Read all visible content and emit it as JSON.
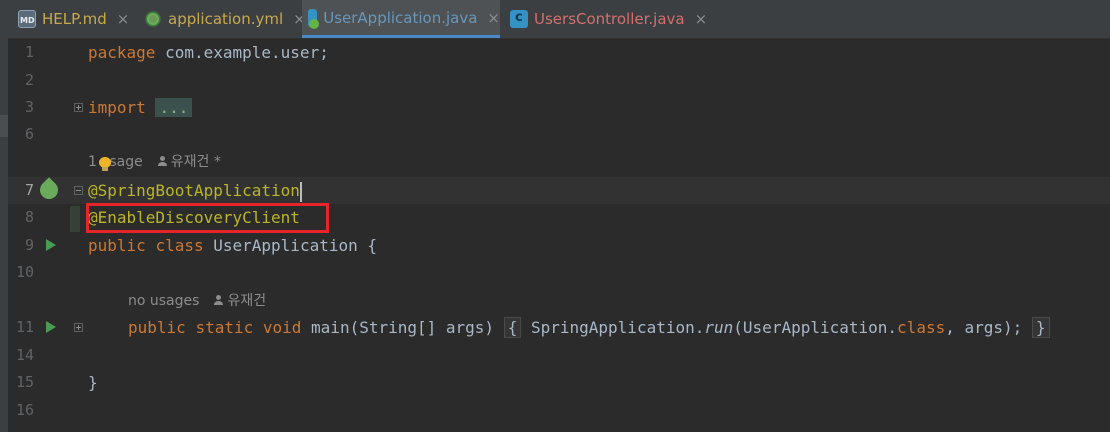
{
  "tabs": [
    {
      "label": "HELP.md",
      "icon": "markdown-file-icon",
      "color": "#c7a94e",
      "active": false
    },
    {
      "label": "application.yml",
      "icon": "yaml-file-icon",
      "color": "#c7a94e",
      "active": false
    },
    {
      "label": "UserApplication.java",
      "icon": "java-class-icon",
      "color": "#6897bb",
      "active": true
    },
    {
      "label": "UsersController.java",
      "icon": "java-class-icon",
      "color": "#d36f6f",
      "active": false
    }
  ],
  "close_glyph": "×",
  "lines": {
    "l1": {
      "num": "1",
      "kw": "package",
      "rest": " com.example.user;"
    },
    "l2": {
      "num": "2"
    },
    "l3": {
      "num": "3",
      "kw": "import",
      "folded": "..."
    },
    "l6": {
      "num": "6"
    },
    "hint1": {
      "usage_pre": "1 ",
      "usage_post": "sage",
      "author": "유재건 *"
    },
    "l7": {
      "num": "7",
      "annotation": "@SpringBootApplication"
    },
    "l8": {
      "num": "8",
      "annotation": "@EnableDiscoveryClient"
    },
    "l9": {
      "num": "9",
      "kw1": "public",
      "kw2": "class",
      "name": " UserApplication {"
    },
    "l10": {
      "num": "10"
    },
    "hint2": {
      "usage": "no usages",
      "author": "유재건"
    },
    "l11": {
      "num": "11",
      "kw1": "public",
      "kw2": "static",
      "kw3": "void",
      "sig": " main(String[] args) ",
      "open": "{",
      "call_pre": " SpringApplication.",
      "call_method": "run",
      "call_args": "(UserApplication.",
      "kw_class": "class",
      "call_end": ", args);",
      "close": "}"
    },
    "l14": {
      "num": "14"
    },
    "l15": {
      "num": "15",
      "text": "}"
    },
    "l16": {
      "num": "16"
    }
  },
  "colors": {
    "keyword": "#cc7832",
    "annotation": "#bbb529",
    "text": "#a9b7c6",
    "highlight_box": "#e8242b",
    "active_tab_underline": "#4a88c7"
  }
}
